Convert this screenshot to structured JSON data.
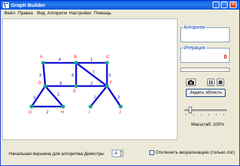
{
  "window": {
    "title": "Graph Builder"
  },
  "titlebar": {
    "minimize": "_",
    "maximize": "□",
    "close": "×"
  },
  "menu": [
    "Файл",
    "Правка",
    "Вид",
    "Алгоритм",
    "Настройки",
    "Помощь"
  ],
  "graph": {
    "nodes": [
      "A",
      "B",
      "C",
      "D",
      "E",
      "F",
      "G",
      "H",
      "I",
      "J"
    ],
    "edges": [
      {
        "from": "A",
        "to": "B",
        "weight": "4"
      },
      {
        "from": "B",
        "to": "C",
        "weight": "1"
      },
      {
        "from": "A",
        "to": "D",
        "weight": "3"
      },
      {
        "from": "B",
        "to": "E",
        "weight": "6"
      },
      {
        "from": "B",
        "to": "F",
        "weight": "7"
      },
      {
        "from": "C",
        "to": "F",
        "weight": "3"
      },
      {
        "from": "D",
        "to": "E",
        "weight": "8"
      },
      {
        "from": "E",
        "to": "F",
        "weight": "2"
      },
      {
        "from": "D",
        "to": "G",
        "weight": "3"
      },
      {
        "from": "D",
        "to": "H",
        "weight": "2"
      },
      {
        "from": "G",
        "to": "H",
        "weight": "2"
      },
      {
        "from": "F",
        "to": "I",
        "weight": "1"
      },
      {
        "from": "F",
        "to": "J",
        "weight": "3"
      }
    ],
    "node_label_color": "#ff2020",
    "edge_color": "#1010d0",
    "node_color": "#16a58a"
  },
  "panel": {
    "algorithm_label": "Алгоритм",
    "iteration_label": "Итерация",
    "iteration_value": "0",
    "progress": 0,
    "set_area_button": "Задать область",
    "scale_label": "Масштаб: 100%",
    "scale_percent": 100
  },
  "bottom": {
    "start_vertex_label": "Начальная вершина для алгоритма Дейкстры",
    "start_vertex_value": "A",
    "disable_viz_label": "Отключить визуализацию (только лог)",
    "disable_viz_checked": false
  },
  "icons": {
    "app": "graph-app-icon",
    "camera": "camera-icon",
    "pause": "pause-icon",
    "stop": "stop-icon"
  }
}
